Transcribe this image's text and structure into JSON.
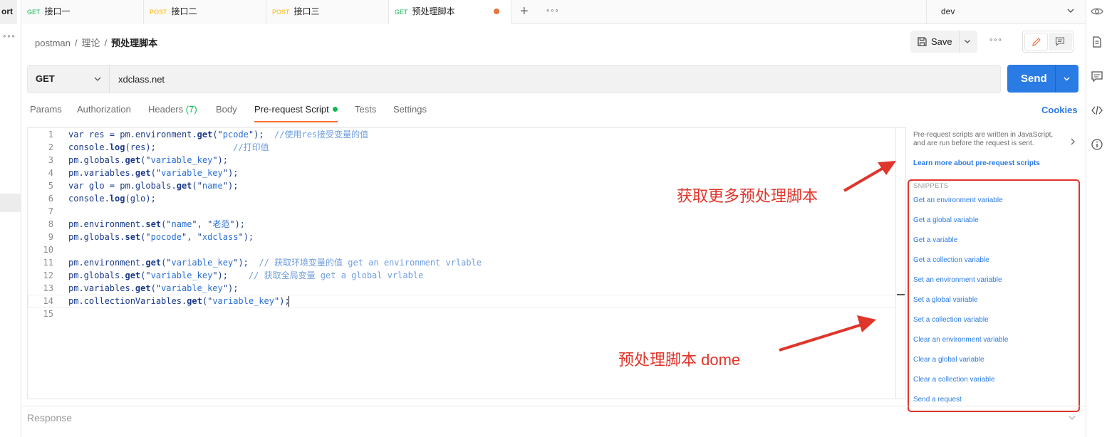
{
  "left": {
    "partial_label": "ort",
    "more": "∘∘∘"
  },
  "tabs": [
    {
      "method": "GET",
      "label": "接口一"
    },
    {
      "method": "POST",
      "label": "接口二"
    },
    {
      "method": "POST",
      "label": "接口三"
    },
    {
      "method": "GET",
      "label": "预处理脚本",
      "active": true,
      "unsaved": true
    }
  ],
  "tabbar": {
    "more": "∘∘∘"
  },
  "environment": {
    "selected": "dev"
  },
  "breadcrumb": {
    "items": [
      "postman",
      "理论"
    ],
    "current": "预处理脚本"
  },
  "toolbar": {
    "save_label": "Save",
    "more": "∘∘∘"
  },
  "request": {
    "method": "GET",
    "url": "xdclass.net",
    "send_label": "Send"
  },
  "request_tabs": [
    {
      "label": "Params"
    },
    {
      "label": "Authorization"
    },
    {
      "label": "Headers",
      "count": "(7)"
    },
    {
      "label": "Body"
    },
    {
      "label": "Pre-request Script",
      "active": true
    },
    {
      "label": "Tests"
    },
    {
      "label": "Settings"
    }
  ],
  "cookies_label": "Cookies",
  "editor": {
    "lines": [
      "1",
      "2",
      "3",
      "4",
      "5",
      "6",
      "7",
      "8",
      "9",
      "10",
      "11",
      "12",
      "13",
      "14",
      "15"
    ]
  },
  "sidebar": {
    "description": "Pre-request scripts are written in JavaScript, and are run before the request is sent.",
    "learn_more": "Learn more about pre-request scripts",
    "snippets_title": "SNIPPETS",
    "snippets": [
      "Get an environment variable",
      "Get a global variable",
      "Get a variable",
      "Get a collection variable",
      "Set an environment variable",
      "Set a global variable",
      "Set a collection variable",
      "Clear an environment variable",
      "Clear a global variable",
      "Clear a collection variable",
      "Send a request"
    ]
  },
  "annotations": {
    "top": "获取更多预处理脚本",
    "bottom": "预处理脚本 dome"
  },
  "response_label": "Response",
  "colors": {
    "accent_blue": "#2a7be4",
    "get_green": "#0cbb52",
    "post_yellow": "#ffb400",
    "annotation_red": "#e0352b",
    "tab_orange": "#ff6c37"
  }
}
